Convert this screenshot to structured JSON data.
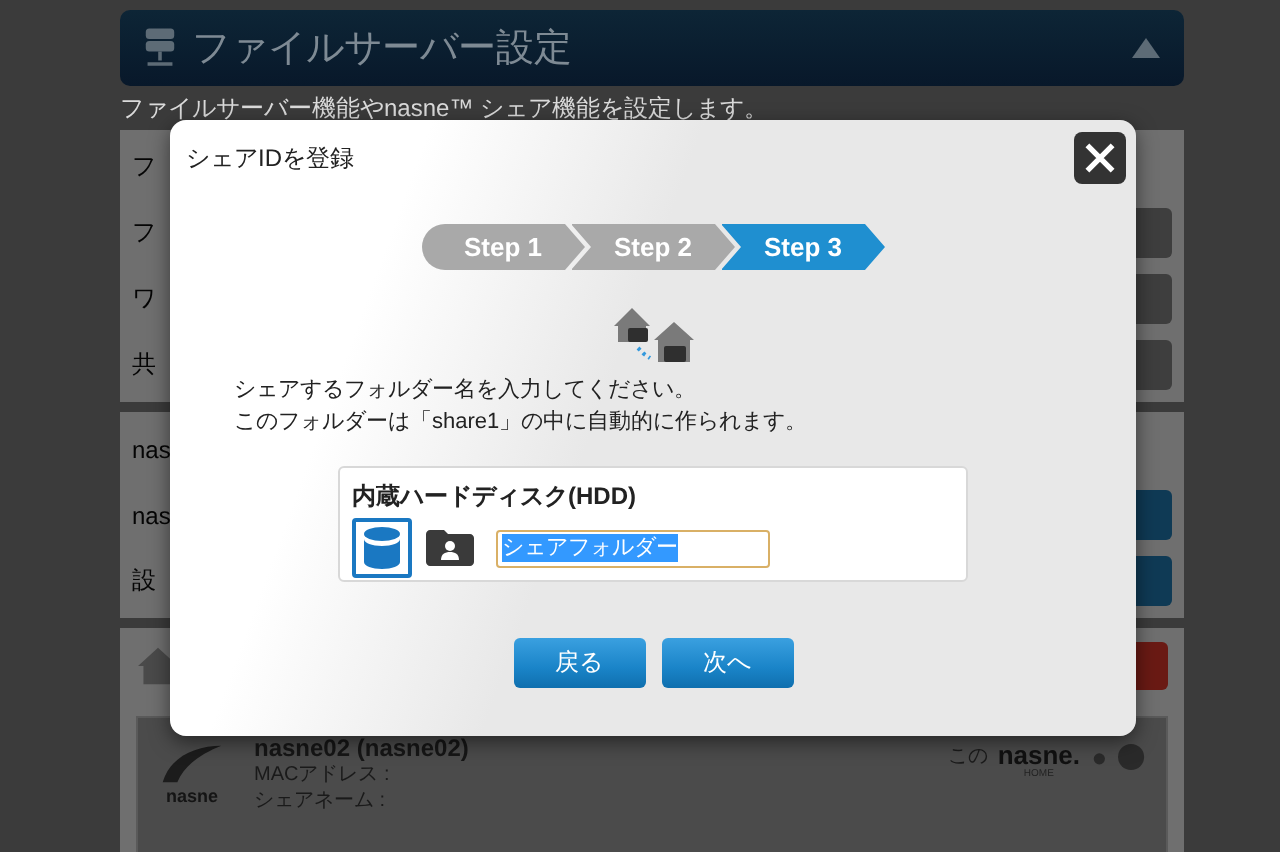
{
  "page": {
    "title": "ファイルサーバー設定",
    "description": "ファイルサーバー機能やnasne™ シェア機能を設定します。",
    "settings_rows": [
      {
        "label": "フ",
        "kind": "plain"
      },
      {
        "label": "フ",
        "kind": "button"
      },
      {
        "label": "ワ",
        "kind": "button"
      },
      {
        "label": "共",
        "kind": "button"
      }
    ],
    "nasne_rows": [
      {
        "label": "nas",
        "kind": "plain"
      },
      {
        "label": "nas",
        "kind": "blue"
      },
      {
        "label": "設",
        "kind": "blue"
      }
    ],
    "device": {
      "logo_caption": "nasne",
      "name": "nasne02 (nasne02)",
      "mac_label": "MACアドレス :",
      "share_label": "シェアネーム :",
      "this_label": "この",
      "logo": "nasne.",
      "logo_sub": "HOME"
    }
  },
  "dialog": {
    "title": "シェアIDを登録",
    "steps": [
      {
        "label": "Step 1",
        "selected": false
      },
      {
        "label": "Step 2",
        "selected": false
      },
      {
        "label": "Step 3",
        "selected": true
      }
    ],
    "instructions": [
      "シェアするフォルダー名を入力してください。",
      "このフォルダーは「share1」の中に自動的に作られます。"
    ],
    "drive": {
      "label": "内蔵ハードディスク(HDD)",
      "selected": true
    },
    "folder_name": "シェアフォルダー",
    "buttons": [
      {
        "label": "戻る"
      },
      {
        "label": "次へ"
      }
    ]
  }
}
